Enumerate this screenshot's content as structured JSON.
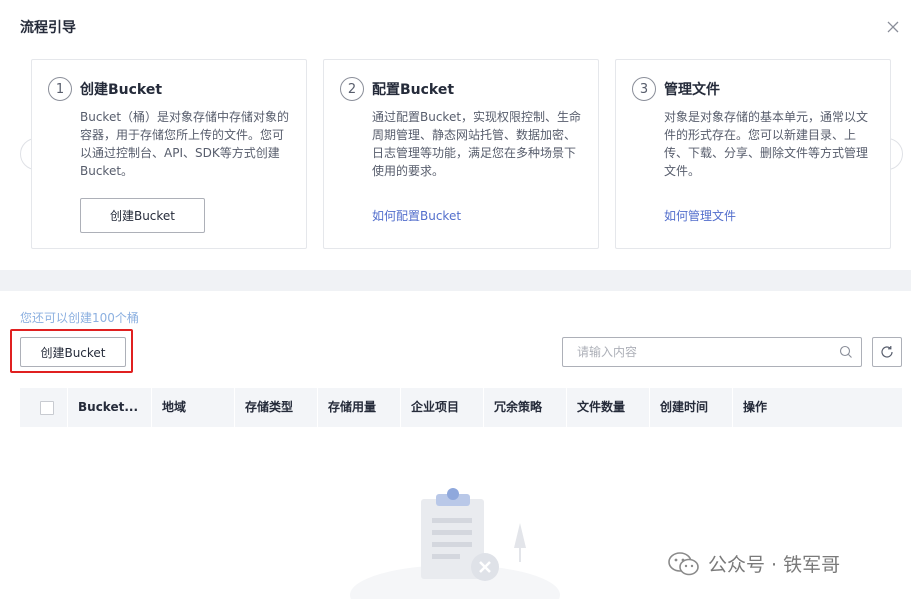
{
  "guide": {
    "title": "流程引导",
    "cards": [
      {
        "num": "1",
        "title": "创建Bucket",
        "desc": "Bucket（桶）是对象存储中存储对象的容器，用于存储您所上传的文件。您可以通过控制台、API、SDK等方式创建Bucket。",
        "button": "创建Bucket"
      },
      {
        "num": "2",
        "title": "配置Bucket",
        "desc": "通过配置Bucket，实现权限控制、生命周期管理、静态网站托管、数据加密、日志管理等功能，满足您在多种场景下使用的要求。",
        "link": "如何配置Bucket"
      },
      {
        "num": "3",
        "title": "管理文件",
        "desc": "对象是对象存储的基本单元，通常以文件的形式存在。您可以新建目录、上传、下载、分享、删除文件等方式管理文件。",
        "link": "如何管理文件"
      }
    ]
  },
  "toolbar": {
    "quota": "您还可以创建100个桶",
    "create_label": "创建Bucket",
    "search_placeholder": "请输入内容"
  },
  "table": {
    "columns": [
      "Bucket...",
      "地域",
      "存储类型",
      "存储用量",
      "企业项目",
      "冗余策略",
      "文件数量",
      "创建时间",
      "操作"
    ]
  },
  "watermark": {
    "text": "公众号 · 铁军哥"
  },
  "icons": {
    "close": "close-icon",
    "prev": "chevron-left-icon",
    "next": "chevron-right-icon",
    "search": "search-icon",
    "refresh": "refresh-icon",
    "empty": "empty-state-illustration",
    "wechat": "wechat-icon"
  },
  "colors": {
    "link": "#526ecc",
    "highlight": "#e02020",
    "quota": "#8cb0e0",
    "table_header_bg": "#f3f5f8"
  }
}
